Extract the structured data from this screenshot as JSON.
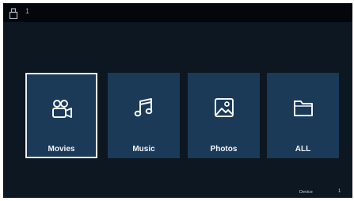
{
  "topbar": {
    "usb_icon": "usb-drive-icon",
    "indicator": "1"
  },
  "tiles": [
    {
      "label": "Movies",
      "icon": "movie-camera-icon",
      "selected": true
    },
    {
      "label": "Music",
      "icon": "music-note-icon",
      "selected": false
    },
    {
      "label": "Photos",
      "icon": "photo-icon",
      "selected": false
    },
    {
      "label": "ALL",
      "icon": "folder-icon",
      "selected": false
    }
  ],
  "footer": {
    "label": "Device",
    "value": "1"
  },
  "colors": {
    "background": "#0c1722",
    "tile": "#1a3a57",
    "selection_border": "#e9eef2",
    "topbar": "#03060a"
  }
}
